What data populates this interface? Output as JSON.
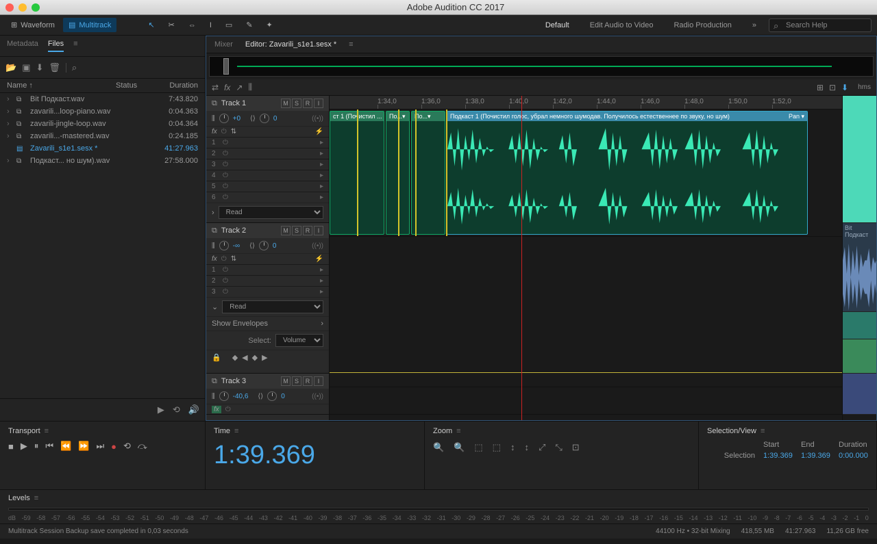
{
  "window": {
    "title": "Adobe Audition CC 2017"
  },
  "toolbar": {
    "waveform": "Waveform",
    "multitrack": "Multitrack",
    "workspaces": [
      "Default",
      "Edit Audio to Video",
      "Radio Production"
    ],
    "search_placeholder": "Search Help"
  },
  "left": {
    "tabs": {
      "metadata": "Metadata",
      "files": "Files"
    },
    "columns": {
      "name": "Name ↑",
      "status": "Status",
      "duration": "Duration"
    },
    "files": [
      {
        "name": "Bit Подкаст.wav",
        "duration": "7:43.820",
        "icon": "wave"
      },
      {
        "name": "zavarili...loop-piano.wav",
        "duration": "0:04.363",
        "icon": "wave"
      },
      {
        "name": "zavarili-jingle-loop.wav",
        "duration": "0:04.364",
        "icon": "wave"
      },
      {
        "name": "zavarili...-mastered.wav",
        "duration": "0:24.185",
        "icon": "wave"
      },
      {
        "name": "Zavarili_s1e1.sesx *",
        "duration": "41:27.963",
        "icon": "session",
        "selected": true
      },
      {
        "name": "Подкаст... но шум).wav",
        "duration": "27:58.000",
        "icon": "wave"
      }
    ]
  },
  "editor": {
    "tabs": {
      "mixer": "Mixer",
      "editor": "Editor: Zavarili_s1e1.sesx *"
    },
    "ruler_unit": "hms",
    "ruler_ticks": [
      "1:34,0",
      "1:36,0",
      "1:38,0",
      "1:40,0",
      "1:42,0",
      "1:44,0",
      "1:46,0",
      "1:48,0",
      "1:50,0",
      "1:52,0"
    ],
    "tracks": [
      {
        "name": "Track 1",
        "vol": "+0",
        "pan": "0",
        "read": "Read",
        "fx_slots": [
          1,
          2,
          3,
          4,
          5,
          6
        ],
        "clip": {
          "label": "Подкаст 1 (Почистил голос, убрал немного шумодав. Получилось естественнее по звуку, но шум)",
          "pan": "Pan ▾"
        },
        "clip_prefix": "ст 1 (Почистил ...  ▾",
        "clip_mid1": "По...▾",
        "clip_mid2": "По...▾"
      },
      {
        "name": "Track 2",
        "vol": "-∞",
        "pan": "0",
        "read": "Read",
        "fx_slots": [
          1,
          2,
          3
        ],
        "show_env": "Show Envelopes",
        "select_label": "Select:",
        "select_val": "Volume",
        "side_clip": "Bit Подкаст"
      },
      {
        "name": "Track 3",
        "vol": "-40,6",
        "pan": "0"
      }
    ]
  },
  "transport": {
    "title": "Transport"
  },
  "time": {
    "title": "Time",
    "value": "1:39.369"
  },
  "zoom": {
    "title": "Zoom"
  },
  "selview": {
    "title": "Selection/View",
    "headers": {
      "start": "Start",
      "end": "End",
      "duration": "Duration"
    },
    "rows": [
      {
        "label": "Selection",
        "start": "1:39.369",
        "end": "1:39.369",
        "dur": "0:00.000"
      }
    ]
  },
  "levels": {
    "title": "Levels",
    "scale": [
      "dB",
      "-59",
      "-58",
      "-57",
      "-56",
      "-55",
      "-54",
      "-53",
      "-52",
      "-51",
      "-50",
      "-49",
      "-48",
      "-47",
      "-46",
      "-45",
      "-44",
      "-43",
      "-42",
      "-41",
      "-40",
      "-39",
      "-38",
      "-37",
      "-36",
      "-35",
      "-34",
      "-33",
      "-32",
      "-31",
      "-30",
      "-29",
      "-28",
      "-27",
      "-26",
      "-25",
      "-24",
      "-23",
      "-22",
      "-21",
      "-20",
      "-19",
      "-18",
      "-17",
      "-16",
      "-15",
      "-14",
      "-13",
      "-12",
      "-11",
      "-10",
      "-9",
      "-8",
      "-7",
      "-6",
      "-5",
      "-4",
      "-3",
      "-2",
      "-1",
      "0"
    ]
  },
  "status": {
    "msg": "Multitrack Session Backup save completed in 0,03 seconds",
    "sample": "44100 Hz • 32-bit Mixing",
    "size": "418,55 MB",
    "length": "41:27.963",
    "disk": "11,26 GB free"
  }
}
